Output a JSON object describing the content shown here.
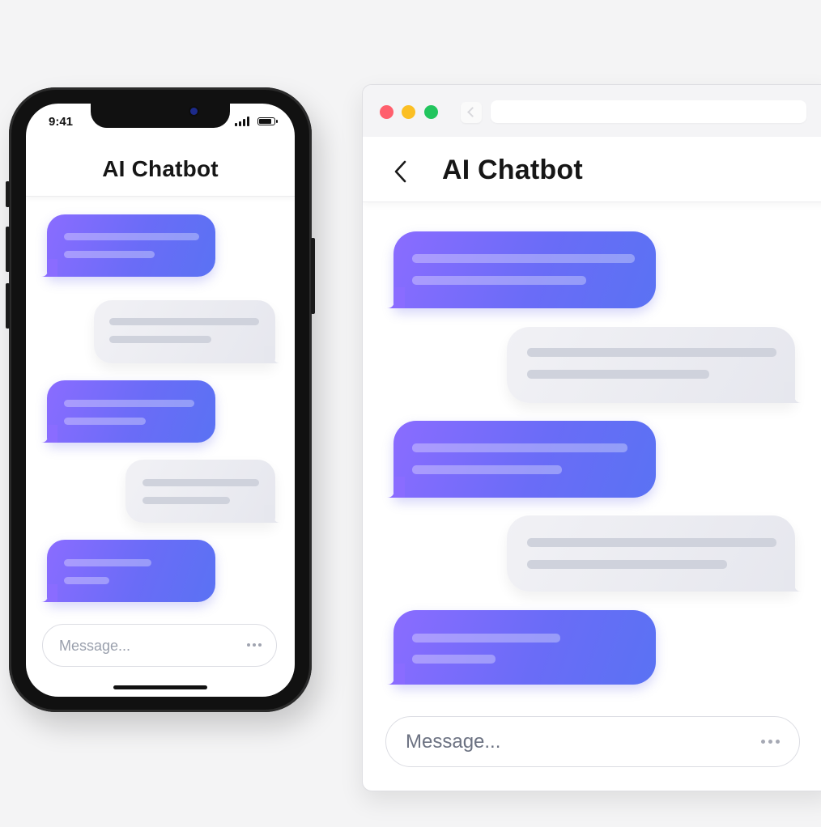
{
  "phone": {
    "status_time": "9:41",
    "title": "AI Chatbot",
    "input_placeholder": "Message..."
  },
  "browser": {
    "title": "AI Chatbot",
    "input_placeholder": "Message...",
    "window_controls": {
      "close_color": "#ff5f6d",
      "minimize_color": "#fbbf24",
      "maximize_color": "#22c55e"
    }
  },
  "colors": {
    "bot_bubble_start": "#8a6cff",
    "bot_bubble_end": "#5a72f3",
    "user_bubble": "#e8e9ef",
    "background": "#f4f4f5"
  },
  "icons": {
    "back": "chevron-left-icon",
    "more": "more-dots-icon",
    "signal": "signal-bars-icon",
    "battery": "battery-icon"
  }
}
